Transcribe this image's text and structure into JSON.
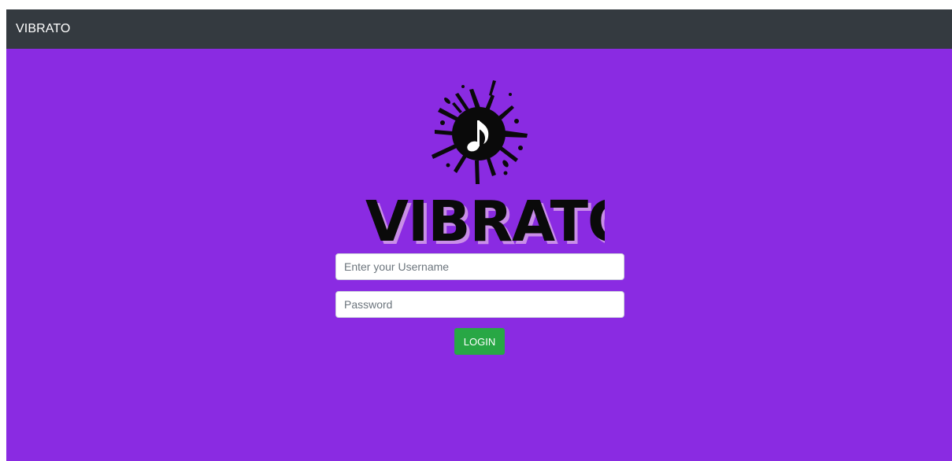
{
  "navbar": {
    "brand": "VIBRATO"
  },
  "logo": {
    "wordmark": "VIBRATO",
    "icon": "music-note-splash-icon",
    "colors": {
      "ink": "#0a0a0a",
      "shadow": "#c98ee8"
    }
  },
  "form": {
    "username_placeholder": "Enter your Username",
    "username_value": "",
    "password_placeholder": "Password",
    "password_value": "",
    "login_label": "LOGIN"
  },
  "colors": {
    "background": "#8a2be2",
    "navbar": "#343a40",
    "login_button": "#28a745"
  }
}
